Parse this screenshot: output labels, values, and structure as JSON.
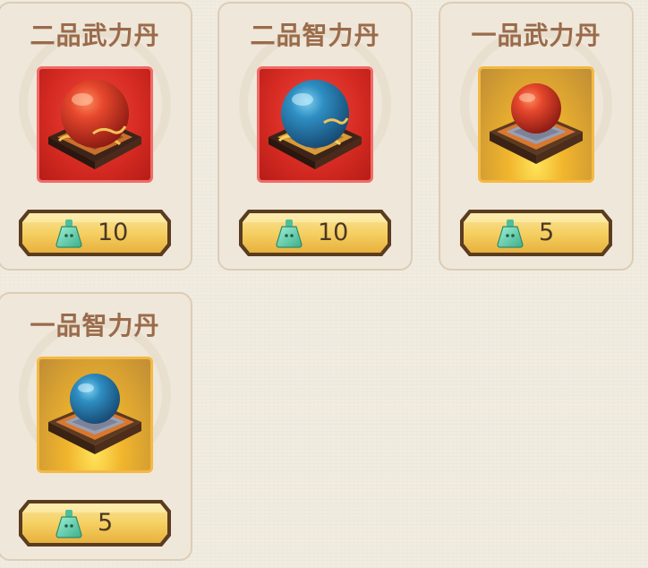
{
  "items": [
    {
      "name": "二品武力丹",
      "price": "10",
      "rarity": "red",
      "orb": "red-orb-icon"
    },
    {
      "name": "二品智力丹",
      "price": "10",
      "rarity": "red",
      "orb": "blue-orb-icon"
    },
    {
      "name": "一品武力丹",
      "price": "5",
      "rarity": "gold",
      "orb": "red-orb-icon"
    },
    {
      "name": "一品智力丹",
      "price": "5",
      "rarity": "gold",
      "orb": "blue-orb-icon"
    }
  ],
  "currency_icon": "jade-bell-icon",
  "colors": {
    "title": "#9a6b4b",
    "red_frame": "#d42a22",
    "gold_frame": "#f1b52d",
    "price_button": "#f6d56f"
  }
}
